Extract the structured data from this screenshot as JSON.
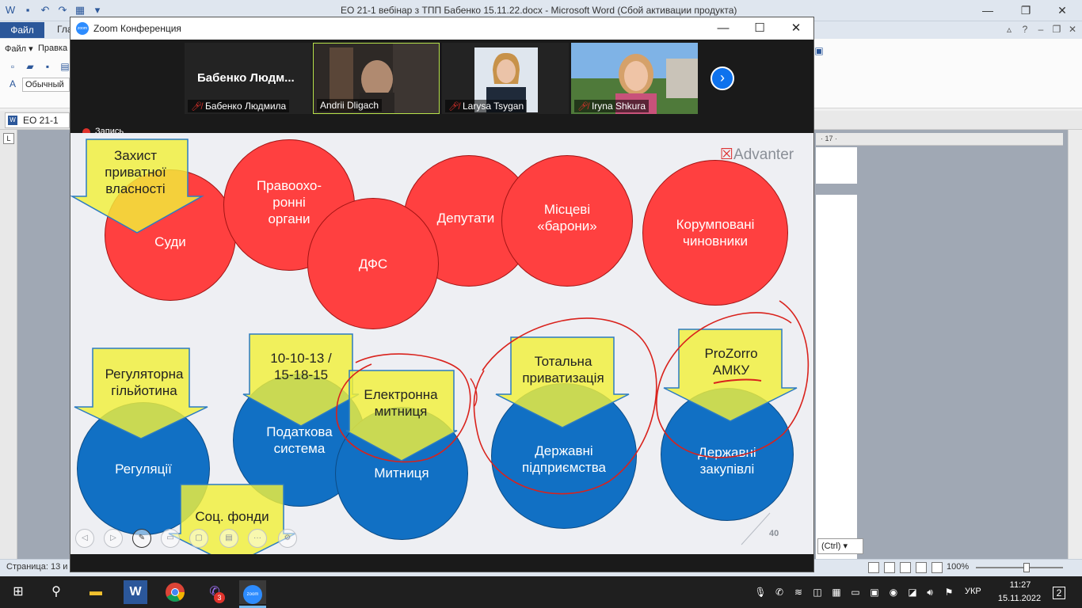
{
  "word": {
    "title": "ЕО 21-1 вебінар з ТПП Бабенко 15.11.22.docx  -  Microsoft Word (Сбой активации продукта)",
    "file_tab": "Файл",
    "tab2": "Гла",
    "menu_file": "Файл ▾",
    "menu_edit": "Правка",
    "style_value": "Обычный",
    "doc_tab": "ЕО 21-1",
    "ruler_number": "· 17 ·",
    "paste_chip": "(Ctrl) ▾",
    "status_page": "Страница: 13 и",
    "zoom_level": "100%"
  },
  "zoom": {
    "window_title": "Zoom Конференция",
    "record_label": "Запись",
    "participants": [
      {
        "display": "Бабенко  Людм...",
        "label": "Бабенко Людмила",
        "muted": true
      },
      {
        "display": "",
        "label": "Andrii Dligach",
        "muted": false
      },
      {
        "display": "",
        "label": "Larysa Tsygan",
        "muted": true
      },
      {
        "display": "",
        "label": "Iryna Shkura",
        "muted": true
      }
    ]
  },
  "slide": {
    "brand": "Advanter",
    "page_number": "40",
    "red_circles": [
      "Суди",
      "Правоохо-\nронні\nоргани",
      "ДФС",
      "Депутати",
      "Місцеві\n«барони»",
      "Корумповані\nчиновники"
    ],
    "blue_circles": [
      "Регуляції",
      "Податкова\nсистема",
      "Митниця",
      "Державні\nпідприємства",
      "Державні\nзакупівлі"
    ],
    "arrows": [
      "Захист\nприватної\nвласності",
      "Регуляторна\nгільйотина",
      "10-10-13 /\n15-18-15",
      "Електронна\nмитниця",
      "Тотальна\nприватизація",
      "ProZorro\nАМКУ",
      "Соц. фонди"
    ],
    "colors": {
      "red": "#ff4040",
      "blue": "#1170c4",
      "arrow": "#f2f03a",
      "ink": "#d9221c"
    }
  },
  "tray": {
    "language": "УКР",
    "time": "11:27",
    "date": "15.11.2022",
    "viber_badge": "3",
    "notifications": "2"
  }
}
